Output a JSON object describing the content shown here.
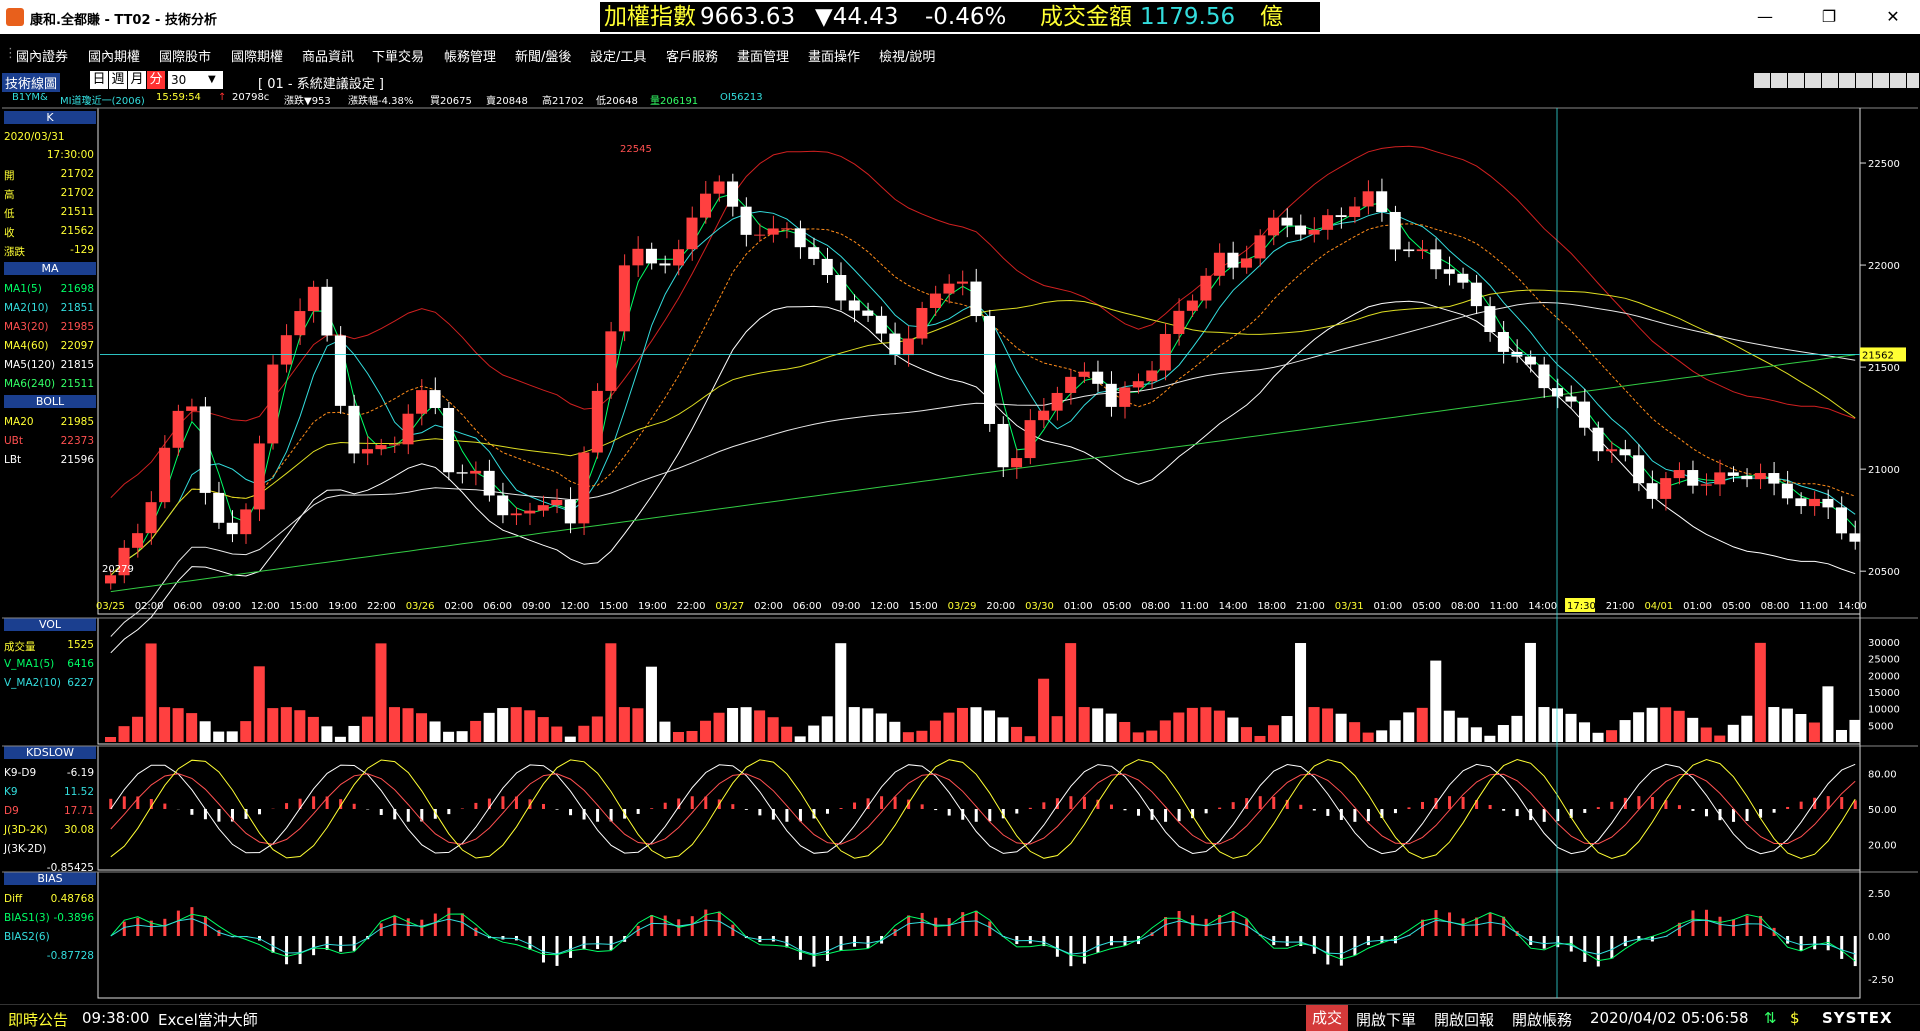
{
  "titlebar": {
    "app_title": "康和.全都賺 - TT02 - 技術分析",
    "index_label": "加權指數",
    "index_value": "9663.63",
    "index_change": "▼44.43",
    "index_pct": "-0.46%",
    "volume_label": "成交金額",
    "volume_value": "1179.56",
    "volume_unit": "億"
  },
  "menu": [
    "國內證券",
    "國內期權",
    "國際股市",
    "國際期權",
    "商品資訊",
    "下單交易",
    "帳務管理",
    "新聞/盤後",
    "設定/工具",
    "客戶服務",
    "畫面管理",
    "畫面操作",
    "檢視/說明"
  ],
  "toolbar": {
    "panel_title": "技術線圖",
    "period_tabs": [
      "日",
      "週",
      "月",
      "分"
    ],
    "active_period": "分",
    "interval_value": "30",
    "scheme_label": "[ 01 - 系統建議設定 ]"
  },
  "quote": {
    "symbol": "B1YM&",
    "name": "MI道瓊近一(2006)",
    "time": "15:59:54",
    "last": "20798c",
    "change": "漲跌▼953",
    "change_pct": "漲跌幅-4.38%",
    "bid": "買20675",
    "ask": "賣20848",
    "high": "高21702",
    "low": "低20648",
    "volume": "量206191",
    "oi": "OI56213"
  },
  "panels": {
    "k": {
      "label": "K",
      "date": "2020/03/31",
      "time": "17:30:00",
      "rows": [
        {
          "k": "開",
          "v": "21702"
        },
        {
          "k": "高",
          "v": "21702"
        },
        {
          "k": "低",
          "v": "21511"
        },
        {
          "k": "收",
          "v": "21562"
        },
        {
          "k": "漲跌",
          "v": "-129"
        }
      ]
    },
    "ma": {
      "label": "MA",
      "rows": [
        {
          "k": "MA1(5)",
          "v": "21698",
          "c": "#00ff66"
        },
        {
          "k": "MA2(10)",
          "v": "21851",
          "c": "#33dddd"
        },
        {
          "k": "MA3(20)",
          "v": "21985",
          "c": "#ff5050"
        },
        {
          "k": "MA4(60)",
          "v": "22097",
          "c": "#ffff33"
        },
        {
          "k": "MA5(120)",
          "v": "21815",
          "c": "#ffffff"
        },
        {
          "k": "MA6(240)",
          "v": "21511",
          "c": "#33ff66"
        }
      ]
    },
    "boll": {
      "label": "BOLL",
      "rows": [
        {
          "k": "MA20",
          "v": "21985",
          "c": "#ffff33"
        },
        {
          "k": "UBt",
          "v": "22373",
          "c": "#ff5050"
        },
        {
          "k": "LBt",
          "v": "21596",
          "c": "#ffffff"
        }
      ]
    },
    "vol": {
      "label": "VOL",
      "rows": [
        {
          "k": "成交量",
          "v": "1525",
          "c": "#ffff33"
        },
        {
          "k": "V_MA1(5)",
          "v": "6416",
          "c": "#00ff66"
        },
        {
          "k": "V_MA2(10)",
          "v": "6227",
          "c": "#33dddd"
        }
      ]
    },
    "kd": {
      "label": "KDSLOW",
      "rows": [
        {
          "k": "K9-D9",
          "v": "-6.19",
          "c": "#ffffff"
        },
        {
          "k": "K9",
          "v": "11.52",
          "c": "#33dddd"
        },
        {
          "k": "D9",
          "v": "17.71",
          "c": "#ff5050"
        },
        {
          "k": "J(3D-2K)",
          "v": "30.08",
          "c": "#ffff33"
        },
        {
          "k": "J(3K-2D)",
          "v": "",
          "c": "#ffffff"
        },
        {
          "k": "",
          "v": "-0.85425",
          "c": "#ffffff"
        }
      ]
    },
    "bias": {
      "label": "BIAS",
      "rows": [
        {
          "k": "Diff",
          "v": "0.48768",
          "c": "#ffff33"
        },
        {
          "k": "BIAS1(3)",
          "v": "-0.3896",
          "c": "#00ff66"
        },
        {
          "k": "BIAS2(6)",
          "v": "",
          "c": "#33dddd"
        },
        {
          "k": "",
          "v": "-0.87728",
          "c": "#33dddd"
        }
      ]
    }
  },
  "chart_data": {
    "type": "candlestick",
    "price_axis": [
      22500,
      22000,
      21500,
      21000,
      20500
    ],
    "price_range": [
      20300,
      22750
    ],
    "current_price_label": "21562",
    "peak_label": "22545",
    "low_label": "20279",
    "time_labels": [
      "03/25",
      "02:00",
      "06:00",
      "09:00",
      "12:00",
      "15:00",
      "19:00",
      "22:00",
      "03/26",
      "02:00",
      "06:00",
      "09:00",
      "12:00",
      "15:00",
      "19:00",
      "22:00",
      "03/27",
      "02:00",
      "06:00",
      "09:00",
      "12:00",
      "15:00",
      "03/29",
      "20:00",
      "03/30",
      "01:00",
      "05:00",
      "08:00",
      "11:00",
      "14:00",
      "18:00",
      "21:00",
      "03/31",
      "01:00",
      "05:00",
      "08:00",
      "11:00",
      "14:00",
      "17:30",
      "21:00",
      "04/01",
      "01:00",
      "05:00",
      "08:00",
      "11:00",
      "14:00"
    ],
    "cursor_time": "17:30",
    "close_series": [
      20450,
      20600,
      20900,
      21200,
      21350,
      20700,
      20650,
      20950,
      21450,
      21700,
      21900,
      21550,
      21150,
      21050,
      21100,
      21300,
      21400,
      21000,
      20950,
      20850,
      20750,
      20800,
      20950,
      20650,
      21300,
      21700,
      22150,
      22050,
      21900,
      22250,
      22450,
      22300,
      22150,
      22100,
      22200,
      22050,
      21900,
      21800,
      21650,
      21600,
      21700,
      21850,
      21950,
      21800,
      21150,
      21000,
      21250,
      21350,
      21400,
      21550,
      21300,
      21400,
      21500,
      21700,
      21900,
      22050,
      21950,
      22100,
      22200,
      22250,
      22150,
      22200,
      22300,
      22350,
      22150,
      22050,
      21950,
      22000,
      21800,
      21700,
      21500,
      21450,
      21400,
      21300,
      21150,
      21050,
      20950,
      20900,
      21000,
      20950,
      20900,
      20950,
      21050,
      20900,
      20850,
      20800,
      20750,
      20700
    ],
    "vol_axis": [
      30000,
      25000,
      20000,
      15000,
      10000,
      5000
    ],
    "kd_axis": [
      "80.00",
      "50.00",
      "20.00"
    ],
    "bias_axis": [
      "2.50",
      "0.00",
      "-2.50"
    ]
  },
  "statusbar": {
    "news_label": "即時公告",
    "news_time": "09:38:00",
    "news_text": "Excel當沖大師",
    "trade_btn": "成交",
    "order_btn": "開啟下單",
    "report_btn": "開啟回報",
    "account_btn": "開啟帳務",
    "datetime": "2020/04/02 05:06:58",
    "vendor": "SYSTEX"
  }
}
